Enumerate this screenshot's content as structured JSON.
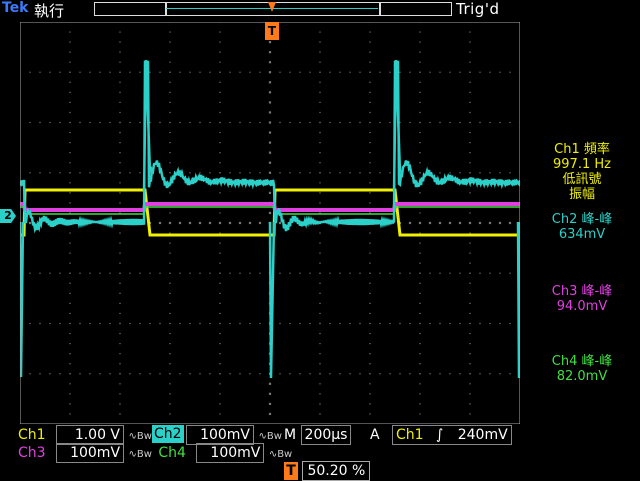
{
  "header": {
    "brand": "Tek",
    "mode": "執行",
    "status": "Trig'd"
  },
  "markers": {
    "trigger_letter": "T",
    "ch2_number": "2"
  },
  "measurements": [
    {
      "channel": "Ch1",
      "name": "頻率",
      "value": "997.1 Hz",
      "note1": "低訊號",
      "note2": "振幅",
      "color": "#f0f000"
    },
    {
      "channel": "Ch2",
      "name": "峰-峰",
      "value": "634mV",
      "color": "#2bd0c8"
    },
    {
      "channel": "Ch3",
      "name": "峰-峰",
      "value": "94.0mV",
      "color": "#e040e0"
    },
    {
      "channel": "Ch4",
      "name": "峰-峰",
      "value": "82.0mV",
      "color": "#40e040"
    }
  ],
  "bottom": {
    "ch1_label": "Ch1",
    "ch1_scale": "1.00 V",
    "ch2_label": "Ch2",
    "ch2_scale": "100mV",
    "ch3_label": "Ch3",
    "ch3_scale": "100mV",
    "ch4_label": "Ch4",
    "ch4_scale": "100mV",
    "bw_symbol": "∿Bw",
    "timebase_label": "M",
    "timebase_value": "200µs",
    "trigger_mode": "A",
    "trigger_source": "Ch1",
    "trigger_slope": "∫",
    "trigger_level": "240mV",
    "trigger_position": "50.20 %"
  },
  "colors": {
    "ch1": "#f0f000",
    "ch2": "#2bd0c8",
    "ch3": "#e040e0",
    "ch4": "#40e040",
    "trigger": "#ff7a1a"
  }
}
